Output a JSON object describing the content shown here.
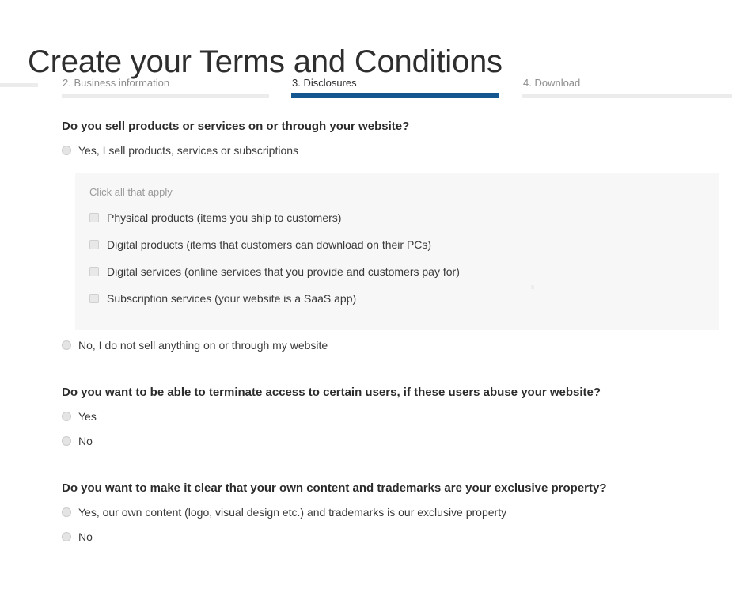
{
  "page": {
    "title": "Create your Terms and Conditions"
  },
  "steps": [
    {
      "label": "",
      "active": false
    },
    {
      "label": "2. Business information",
      "active": false
    },
    {
      "label": "3. Disclosures",
      "active": true
    },
    {
      "label": "4. Download",
      "active": false
    }
  ],
  "colors": {
    "active_step": "#14568f",
    "inactive_step": "#ececec",
    "panel_background": "#f7f7f7",
    "title": "#2e2e2e"
  },
  "questions": [
    {
      "title": "Do you sell products or services on or through your website?",
      "options": [
        {
          "label": "Yes, I sell products, services or subscriptions",
          "selected": false
        },
        {
          "label": "No, I do not sell anything on or through my website",
          "selected": false
        }
      ],
      "panel": {
        "hint": "Click all that apply",
        "checkboxes": [
          {
            "label": "Physical products (items you ship to customers)",
            "checked": false
          },
          {
            "label": "Digital products (items that customers can download on their PCs)",
            "checked": false
          },
          {
            "label": "Digital services (online services that you provide and customers pay for)",
            "checked": false
          },
          {
            "label": "Subscription services (your website is a SaaS app)",
            "checked": false
          }
        ]
      }
    },
    {
      "title": "Do you want to be able to terminate access to certain users, if these users abuse your website?",
      "options": [
        {
          "label": "Yes",
          "selected": false
        },
        {
          "label": "No",
          "selected": false
        }
      ]
    },
    {
      "title": "Do you want to make it clear that your own content and trademarks are your exclusive property?",
      "options": [
        {
          "label": "Yes, our own content (logo, visual design etc.) and trademarks is our exclusive property",
          "selected": false
        },
        {
          "label": "No",
          "selected": false
        }
      ]
    }
  ]
}
